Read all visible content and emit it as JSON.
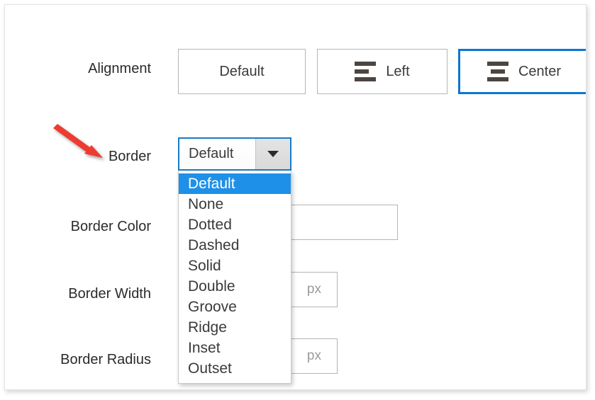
{
  "form": {
    "rows": [
      {
        "label": "Alignment"
      },
      {
        "label": "Border"
      },
      {
        "label": "Border Color"
      },
      {
        "label": "Border Width"
      },
      {
        "label": "Border Radius"
      }
    ]
  },
  "alignment": {
    "label": "Alignment",
    "options": [
      {
        "label": "Default",
        "icon": "none",
        "selected": false
      },
      {
        "label": "Left",
        "icon": "align-left",
        "selected": false
      },
      {
        "label": "Center",
        "icon": "align-center",
        "selected": true
      }
    ],
    "selected_value": "Center",
    "selected_border_color": "#0b77d3"
  },
  "border": {
    "label": "Border",
    "select_value": "Default",
    "caret_icon": "chevron-down-icon",
    "focus_border_color": "#1a7bc4",
    "highlight_color": "#1e90e8",
    "options": [
      "Default",
      "None",
      "Dotted",
      "Dashed",
      "Solid",
      "Double",
      "Groove",
      "Ridge",
      "Inset",
      "Outset"
    ],
    "highlighted_option": "Default"
  },
  "border_color": {
    "label": "Border Color",
    "value": "",
    "placeholder": ""
  },
  "border_width": {
    "label": "Border Width",
    "value": "",
    "placeholder": "px"
  },
  "border_radius": {
    "label": "Border Radius",
    "value": "",
    "placeholder": "px"
  },
  "annotation": {
    "arrow_color": "#ee3b31",
    "points_at": "Border"
  }
}
